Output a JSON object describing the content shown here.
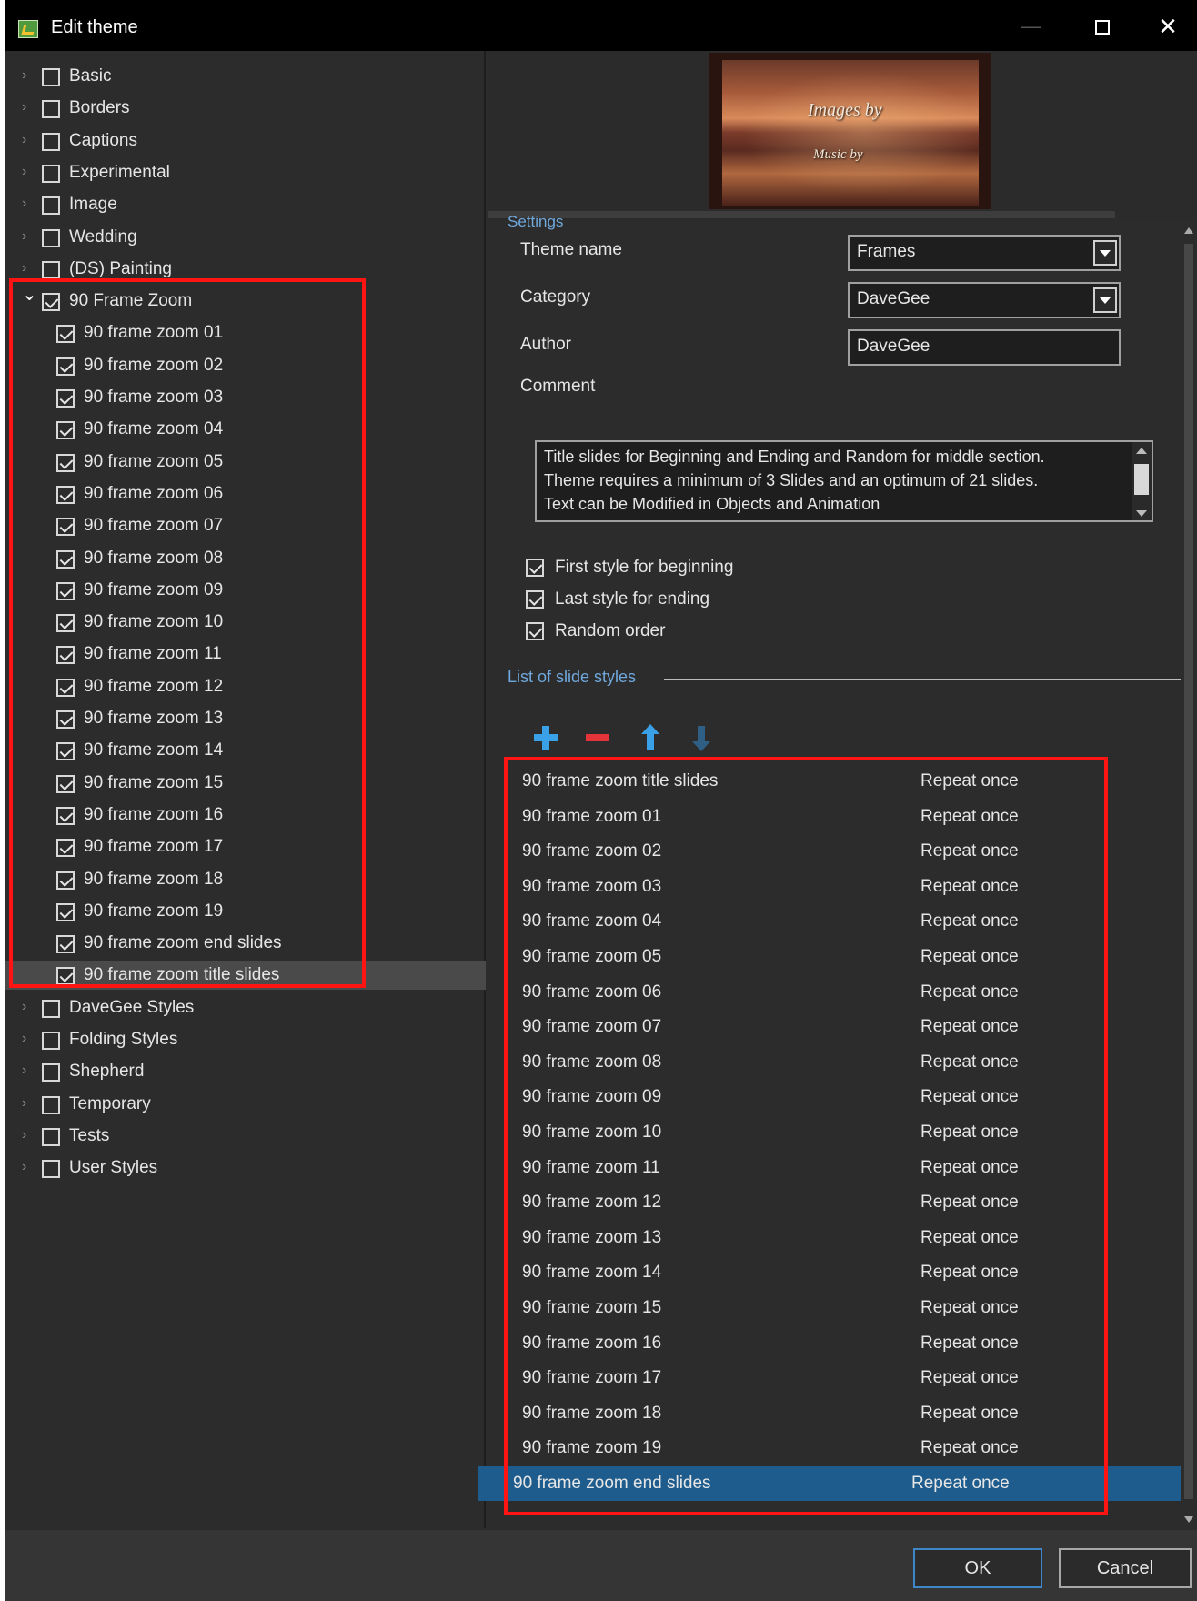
{
  "window": {
    "title": "Edit theme",
    "controls": {
      "minimize": "—",
      "maximize": "□",
      "close": "✕"
    }
  },
  "tree": {
    "items": [
      {
        "label": "Basic",
        "checked": false,
        "expanded": false,
        "level": 0
      },
      {
        "label": "Borders",
        "checked": false,
        "expanded": false,
        "level": 0
      },
      {
        "label": "Captions",
        "checked": false,
        "expanded": false,
        "level": 0
      },
      {
        "label": "Experimental",
        "checked": false,
        "expanded": false,
        "level": 0
      },
      {
        "label": "Image",
        "checked": false,
        "expanded": false,
        "level": 0
      },
      {
        "label": "Wedding",
        "checked": false,
        "expanded": false,
        "level": 0
      },
      {
        "label": "(DS) Painting",
        "checked": false,
        "expanded": false,
        "level": 0
      },
      {
        "label": "90 Frame Zoom",
        "checked": true,
        "expanded": true,
        "level": 0
      },
      {
        "label": "90 frame zoom 01",
        "checked": true,
        "level": 1
      },
      {
        "label": "90 frame zoom 02",
        "checked": true,
        "level": 1
      },
      {
        "label": "90 frame zoom 03",
        "checked": true,
        "level": 1
      },
      {
        "label": "90 frame zoom 04",
        "checked": true,
        "level": 1
      },
      {
        "label": "90 frame zoom 05",
        "checked": true,
        "level": 1
      },
      {
        "label": "90 frame zoom 06",
        "checked": true,
        "level": 1
      },
      {
        "label": "90 frame zoom 07",
        "checked": true,
        "level": 1
      },
      {
        "label": "90 frame zoom 08",
        "checked": true,
        "level": 1
      },
      {
        "label": "90 frame zoom 09",
        "checked": true,
        "level": 1
      },
      {
        "label": "90 frame zoom 10",
        "checked": true,
        "level": 1
      },
      {
        "label": "90 frame zoom 11",
        "checked": true,
        "level": 1
      },
      {
        "label": "90 frame zoom 12",
        "checked": true,
        "level": 1
      },
      {
        "label": "90 frame zoom 13",
        "checked": true,
        "level": 1
      },
      {
        "label": "90 frame zoom 14",
        "checked": true,
        "level": 1
      },
      {
        "label": "90 frame zoom 15",
        "checked": true,
        "level": 1
      },
      {
        "label": "90 frame zoom 16",
        "checked": true,
        "level": 1
      },
      {
        "label": "90 frame zoom 17",
        "checked": true,
        "level": 1
      },
      {
        "label": "90 frame zoom 18",
        "checked": true,
        "level": 1
      },
      {
        "label": "90 frame zoom 19",
        "checked": true,
        "level": 1
      },
      {
        "label": "90 frame zoom end slides",
        "checked": true,
        "level": 1
      },
      {
        "label": "90 frame zoom title slides",
        "checked": true,
        "level": 1,
        "selected": true
      },
      {
        "label": "DaveGee Styles",
        "checked": false,
        "expanded": false,
        "level": 0
      },
      {
        "label": "Folding Styles",
        "checked": false,
        "expanded": false,
        "level": 0
      },
      {
        "label": "Shepherd",
        "checked": false,
        "expanded": false,
        "level": 0
      },
      {
        "label": "Temporary",
        "checked": false,
        "expanded": false,
        "level": 0
      },
      {
        "label": "Tests",
        "checked": false,
        "expanded": false,
        "level": 0
      },
      {
        "label": "User Styles",
        "checked": false,
        "expanded": false,
        "level": 0
      }
    ]
  },
  "preview": {
    "line1": "Images by",
    "line2": "Music by"
  },
  "settings": {
    "header": "Settings",
    "theme_name_label": "Theme name",
    "theme_name_value": "Frames",
    "category_label": "Category",
    "category_value": "DaveGee",
    "author_label": "Author",
    "author_value": "DaveGee",
    "comment_label": "Comment",
    "comment_lines": [
      "Title slides for Beginning and Ending and Random for middle section.",
      "Theme requires a minimum of 3 Slides and an optimum of 21 slides.",
      "Text can be Modified in Objects and Animation"
    ],
    "options": [
      {
        "label": "First style for beginning",
        "checked": true
      },
      {
        "label": "Last style for ending",
        "checked": true
      },
      {
        "label": "Random order",
        "checked": true
      }
    ]
  },
  "slide_styles": {
    "section_title": "List of slide styles",
    "toolbar_icons": [
      "add-icon",
      "remove-icon",
      "move-up-icon",
      "move-down-icon"
    ],
    "rows": [
      {
        "name": "90 frame zoom title slides",
        "repeat": "Repeat once"
      },
      {
        "name": "90 frame zoom 01",
        "repeat": "Repeat once"
      },
      {
        "name": "90 frame zoom 02",
        "repeat": "Repeat once"
      },
      {
        "name": "90 frame zoom 03",
        "repeat": "Repeat once"
      },
      {
        "name": "90 frame zoom 04",
        "repeat": "Repeat once"
      },
      {
        "name": "90 frame zoom 05",
        "repeat": "Repeat once"
      },
      {
        "name": "90 frame zoom 06",
        "repeat": "Repeat once"
      },
      {
        "name": "90 frame zoom 07",
        "repeat": "Repeat once"
      },
      {
        "name": "90 frame zoom 08",
        "repeat": "Repeat once"
      },
      {
        "name": "90 frame zoom 09",
        "repeat": "Repeat once"
      },
      {
        "name": "90 frame zoom 10",
        "repeat": "Repeat once"
      },
      {
        "name": "90 frame zoom 11",
        "repeat": "Repeat once"
      },
      {
        "name": "90 frame zoom 12",
        "repeat": "Repeat once"
      },
      {
        "name": "90 frame zoom 13",
        "repeat": "Repeat once"
      },
      {
        "name": "90 frame zoom 14",
        "repeat": "Repeat once"
      },
      {
        "name": "90 frame zoom 15",
        "repeat": "Repeat once"
      },
      {
        "name": "90 frame zoom 16",
        "repeat": "Repeat once"
      },
      {
        "name": "90 frame zoom 17",
        "repeat": "Repeat once"
      },
      {
        "name": "90 frame zoom 18",
        "repeat": "Repeat once"
      },
      {
        "name": "90 frame zoom 19",
        "repeat": "Repeat once"
      },
      {
        "name": "90 frame zoom end slides",
        "repeat": "Repeat once",
        "selected": true
      }
    ]
  },
  "footer": {
    "ok_label": "OK",
    "cancel_label": "Cancel"
  },
  "colors": {
    "background": "#2c2c2c",
    "accent_blue": "#3aa0e8",
    "selection": "#1d5c8c",
    "annotation_red": "#ff1414"
  }
}
